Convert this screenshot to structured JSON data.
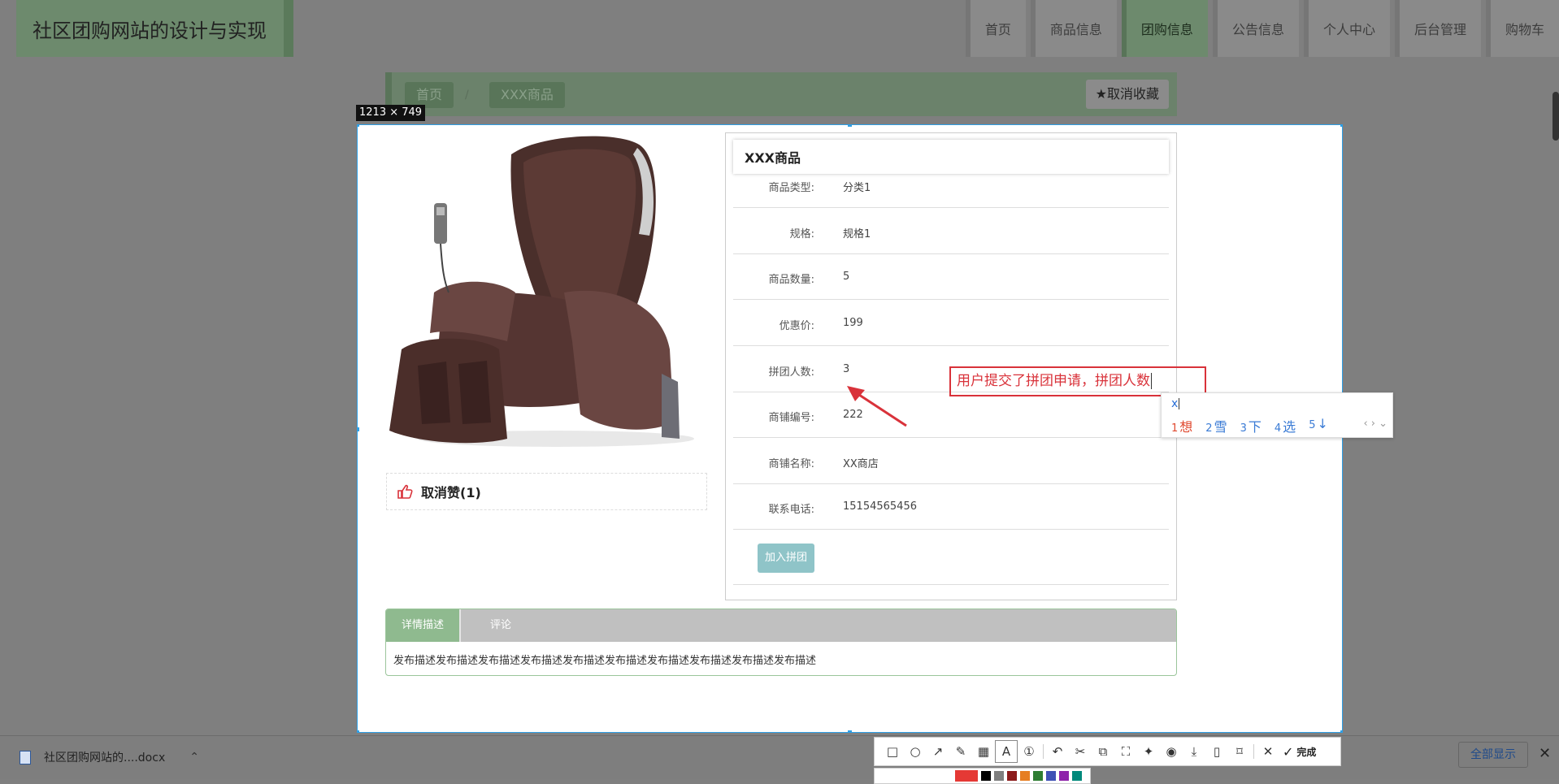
{
  "site": {
    "title": "社区团购网站的设计与实现",
    "nav": [
      "首页",
      "商品信息",
      "团购信息",
      "公告信息",
      "个人中心",
      "后台管理",
      "购物车"
    ],
    "nav_active_index": 2
  },
  "breadcrumb": {
    "home": "首页",
    "separator": "/",
    "current": "XXX商品"
  },
  "favorite_button": "取消收藏",
  "capture": {
    "size_label": "1213 × 749"
  },
  "product": {
    "name": "XXX商品",
    "like_label": "取消赞(1)",
    "fields": [
      {
        "label": "商品类型:",
        "value": "分类1"
      },
      {
        "label": "规格:",
        "value": "规格1"
      },
      {
        "label": "商品数量:",
        "value": "5"
      },
      {
        "label": "优惠价:",
        "value": "199"
      },
      {
        "label": "拼团人数:",
        "value": "3"
      },
      {
        "label": "商铺编号:",
        "value": "222"
      },
      {
        "label": "商铺名称:",
        "value": "XX商店"
      },
      {
        "label": "联系电话:",
        "value": "15154565456"
      }
    ],
    "join_button": "加入拼团",
    "tabs": [
      "详情描述",
      "评论"
    ],
    "active_tab": 0,
    "description": "发布描述发布描述发布描述发布描述发布描述发布描述发布描述发布描述发布描述发布描述"
  },
  "annotation": {
    "text": "用户提交了拼团申请，拼团人数",
    "color": "#d9323a"
  },
  "ime": {
    "input": "x",
    "candidates": [
      {
        "n": "1",
        "text": "想"
      },
      {
        "n": "2",
        "text": "雪"
      },
      {
        "n": "3",
        "text": "下"
      },
      {
        "n": "4",
        "text": "选"
      },
      {
        "n": "5",
        "text": "↓"
      }
    ],
    "nav": "‹ › ⌄"
  },
  "toolbar": {
    "tools": [
      "rectangle-icon",
      "ellipse-icon",
      "arrow-icon",
      "pen-icon",
      "mosaic-icon",
      "text-icon",
      "number-icon",
      "undo-icon",
      "cut-icon",
      "ocr-icon",
      "crop-icon",
      "pin-icon",
      "record-icon",
      "download-icon",
      "phone-icon",
      "bookmark-icon",
      "close-icon",
      "check-icon"
    ],
    "done_label": "完成",
    "colors": [
      "#e53935",
      "#000000",
      "#7f7f7f",
      "#8b1a1a",
      "#e67e22",
      "#2e7d32",
      "#3f51b5",
      "#8e24aa",
      "#00897b"
    ]
  },
  "downloads": {
    "file": "社区团购网站的....docx",
    "show_all": "全部显示"
  },
  "colors": {
    "accent_green": "#8fba8f",
    "selection_blue": "#2e9fe6",
    "join_button": "#8fc4c8"
  }
}
